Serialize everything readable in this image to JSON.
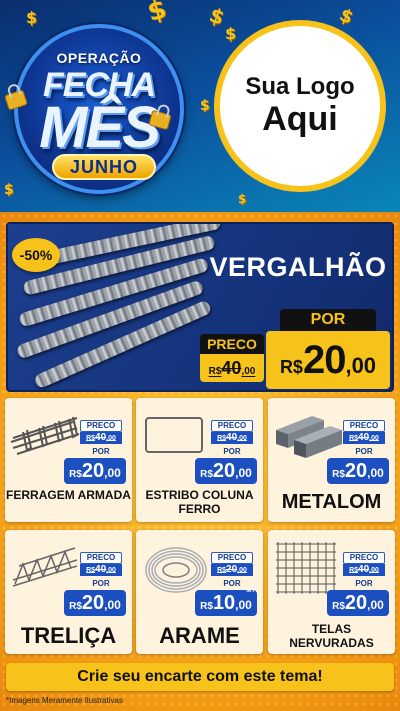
{
  "header": {
    "badge": {
      "line1": "OPERAÇÃO",
      "line2": "FECHA",
      "line3": "MÊS",
      "ribbon": "JUNHO"
    },
    "logo": {
      "line1": "Sua Logo",
      "line2": "Aqui"
    }
  },
  "hero": {
    "discount": "-50%",
    "title": "VERGALHÃO",
    "preco_label": "PRECO",
    "por_label": "POR",
    "old_currency": "R$",
    "old_price": "40",
    "old_cents": ",00",
    "new_currency": "R$",
    "new_price": "20",
    "new_cents": ",00"
  },
  "products": [
    {
      "name": "FERRAGEM ARMADA",
      "preco_label": "PRECO",
      "por_label": "POR",
      "old_currency": "R$",
      "old_price": "40",
      "old_cents": ",00",
      "new_currency": "R$",
      "new_price": "20",
      "new_cents": ",00",
      "unit": ""
    },
    {
      "name": "ESTRIBO COLUNA FERRO",
      "preco_label": "PRECO",
      "por_label": "POR",
      "old_currency": "R$",
      "old_price": "40",
      "old_cents": ",00",
      "new_currency": "R$",
      "new_price": "20",
      "new_cents": ",00",
      "unit": ""
    },
    {
      "name": "METALOM",
      "preco_label": "PRECO",
      "por_label": "POR",
      "old_currency": "R$",
      "old_price": "40",
      "old_cents": ",00",
      "new_currency": "R$",
      "new_price": "20",
      "new_cents": ",00",
      "unit": ""
    },
    {
      "name": "TRELIÇA",
      "preco_label": "PRECO",
      "por_label": "POR",
      "old_currency": "R$",
      "old_price": "40",
      "old_cents": ",00",
      "new_currency": "R$",
      "new_price": "20",
      "new_cents": ",00",
      "unit": ""
    },
    {
      "name": "ARAME",
      "preco_label": "PRECO",
      "por_label": "POR",
      "old_currency": "R$",
      "old_price": "20",
      "old_cents": ",00",
      "new_currency": "R$",
      "new_price": "10",
      "new_cents": ",00",
      "unit": "MT"
    },
    {
      "name": "TELAS NERVURADAS",
      "preco_label": "PRECO",
      "por_label": "POR",
      "old_currency": "R$",
      "old_price": "40",
      "old_cents": ",00",
      "new_currency": "R$",
      "new_price": "20",
      "new_cents": ",00",
      "unit": ""
    }
  ],
  "cta": {
    "label": "Crie seu encarte com este tema!"
  },
  "disclaimer": "*Imagens Meramente Ilustrativas",
  "colors": {
    "yellow": "#f7c21a",
    "navy": "#15337b",
    "price_blue": "#1c4fc0",
    "orange": "#f39a12"
  }
}
